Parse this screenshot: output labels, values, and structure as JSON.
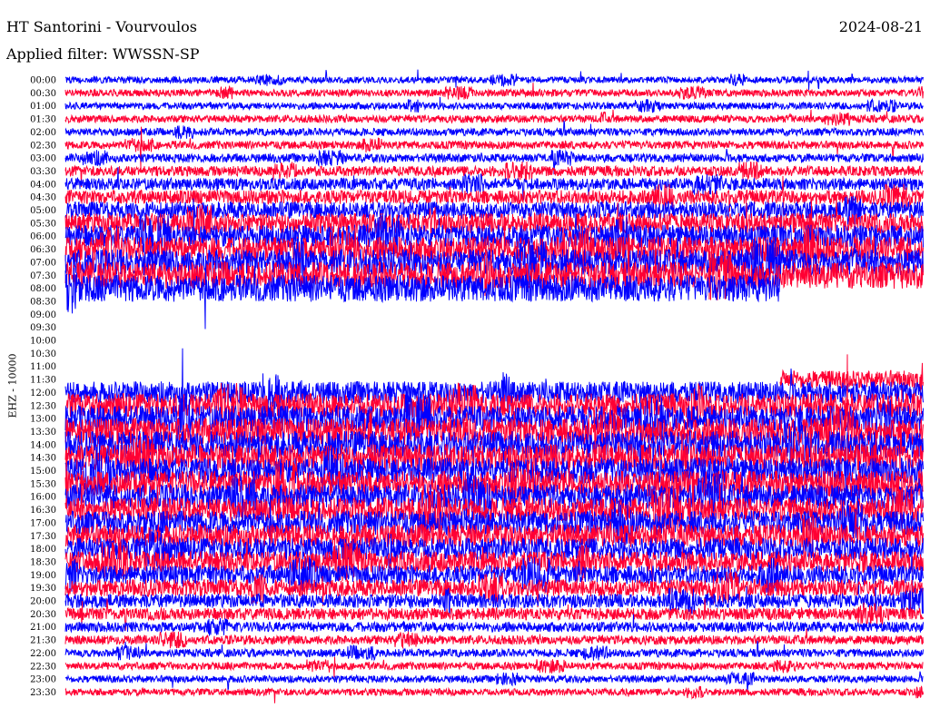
{
  "header": {
    "station": "HT Santorini - Vourvoulos",
    "filter_line": "Applied filter: WWSSN-SP",
    "date": "2024-08-21",
    "channel_label": "EHZ - 10000"
  },
  "chart_data": {
    "type": "helicorder",
    "title": "HT Santorini - Vourvoulos",
    "date": "2024-08-21",
    "filter": "WWSSN-SP",
    "ylabel": "EHZ - 10000",
    "row_labels": [
      "00:00",
      "00:30",
      "01:00",
      "01:30",
      "02:00",
      "02:30",
      "03:00",
      "03:30",
      "04:00",
      "04:30",
      "05:00",
      "05:30",
      "06:00",
      "06:30",
      "07:00",
      "07:30",
      "08:00",
      "08:30",
      "09:00",
      "09:30",
      "10:00",
      "10:30",
      "11:00",
      "11:30",
      "12:00",
      "12:30",
      "13:00",
      "13:30",
      "14:00",
      "14:30",
      "15:00",
      "15:30",
      "16:00",
      "16:30",
      "17:00",
      "17:30",
      "18:00",
      "18:30",
      "19:00",
      "19:30",
      "20:00",
      "20:30",
      "21:00",
      "21:30",
      "22:00",
      "22:30",
      "23:00",
      "23:30"
    ],
    "trace_colors": [
      "#0000ff",
      "#ff0033"
    ],
    "row_noise_level": [
      0.25,
      0.3,
      0.3,
      0.35,
      0.35,
      0.4,
      0.45,
      0.6,
      0.8,
      1.0,
      1.3,
      1.6,
      1.9,
      2.1,
      2.2,
      2.3,
      2.3,
      0,
      0,
      0,
      0,
      0,
      0,
      1.4,
      1.8,
      2.0,
      2.2,
      2.3,
      2.3,
      2.3,
      2.2,
      2.2,
      2.1,
      2.0,
      2.0,
      1.9,
      1.8,
      1.7,
      1.5,
      1.3,
      1.0,
      0.8,
      0.6,
      0.5,
      0.4,
      0.35,
      0.3,
      0.3
    ],
    "data_gap": {
      "start": "08:25",
      "end": "11:55"
    }
  }
}
